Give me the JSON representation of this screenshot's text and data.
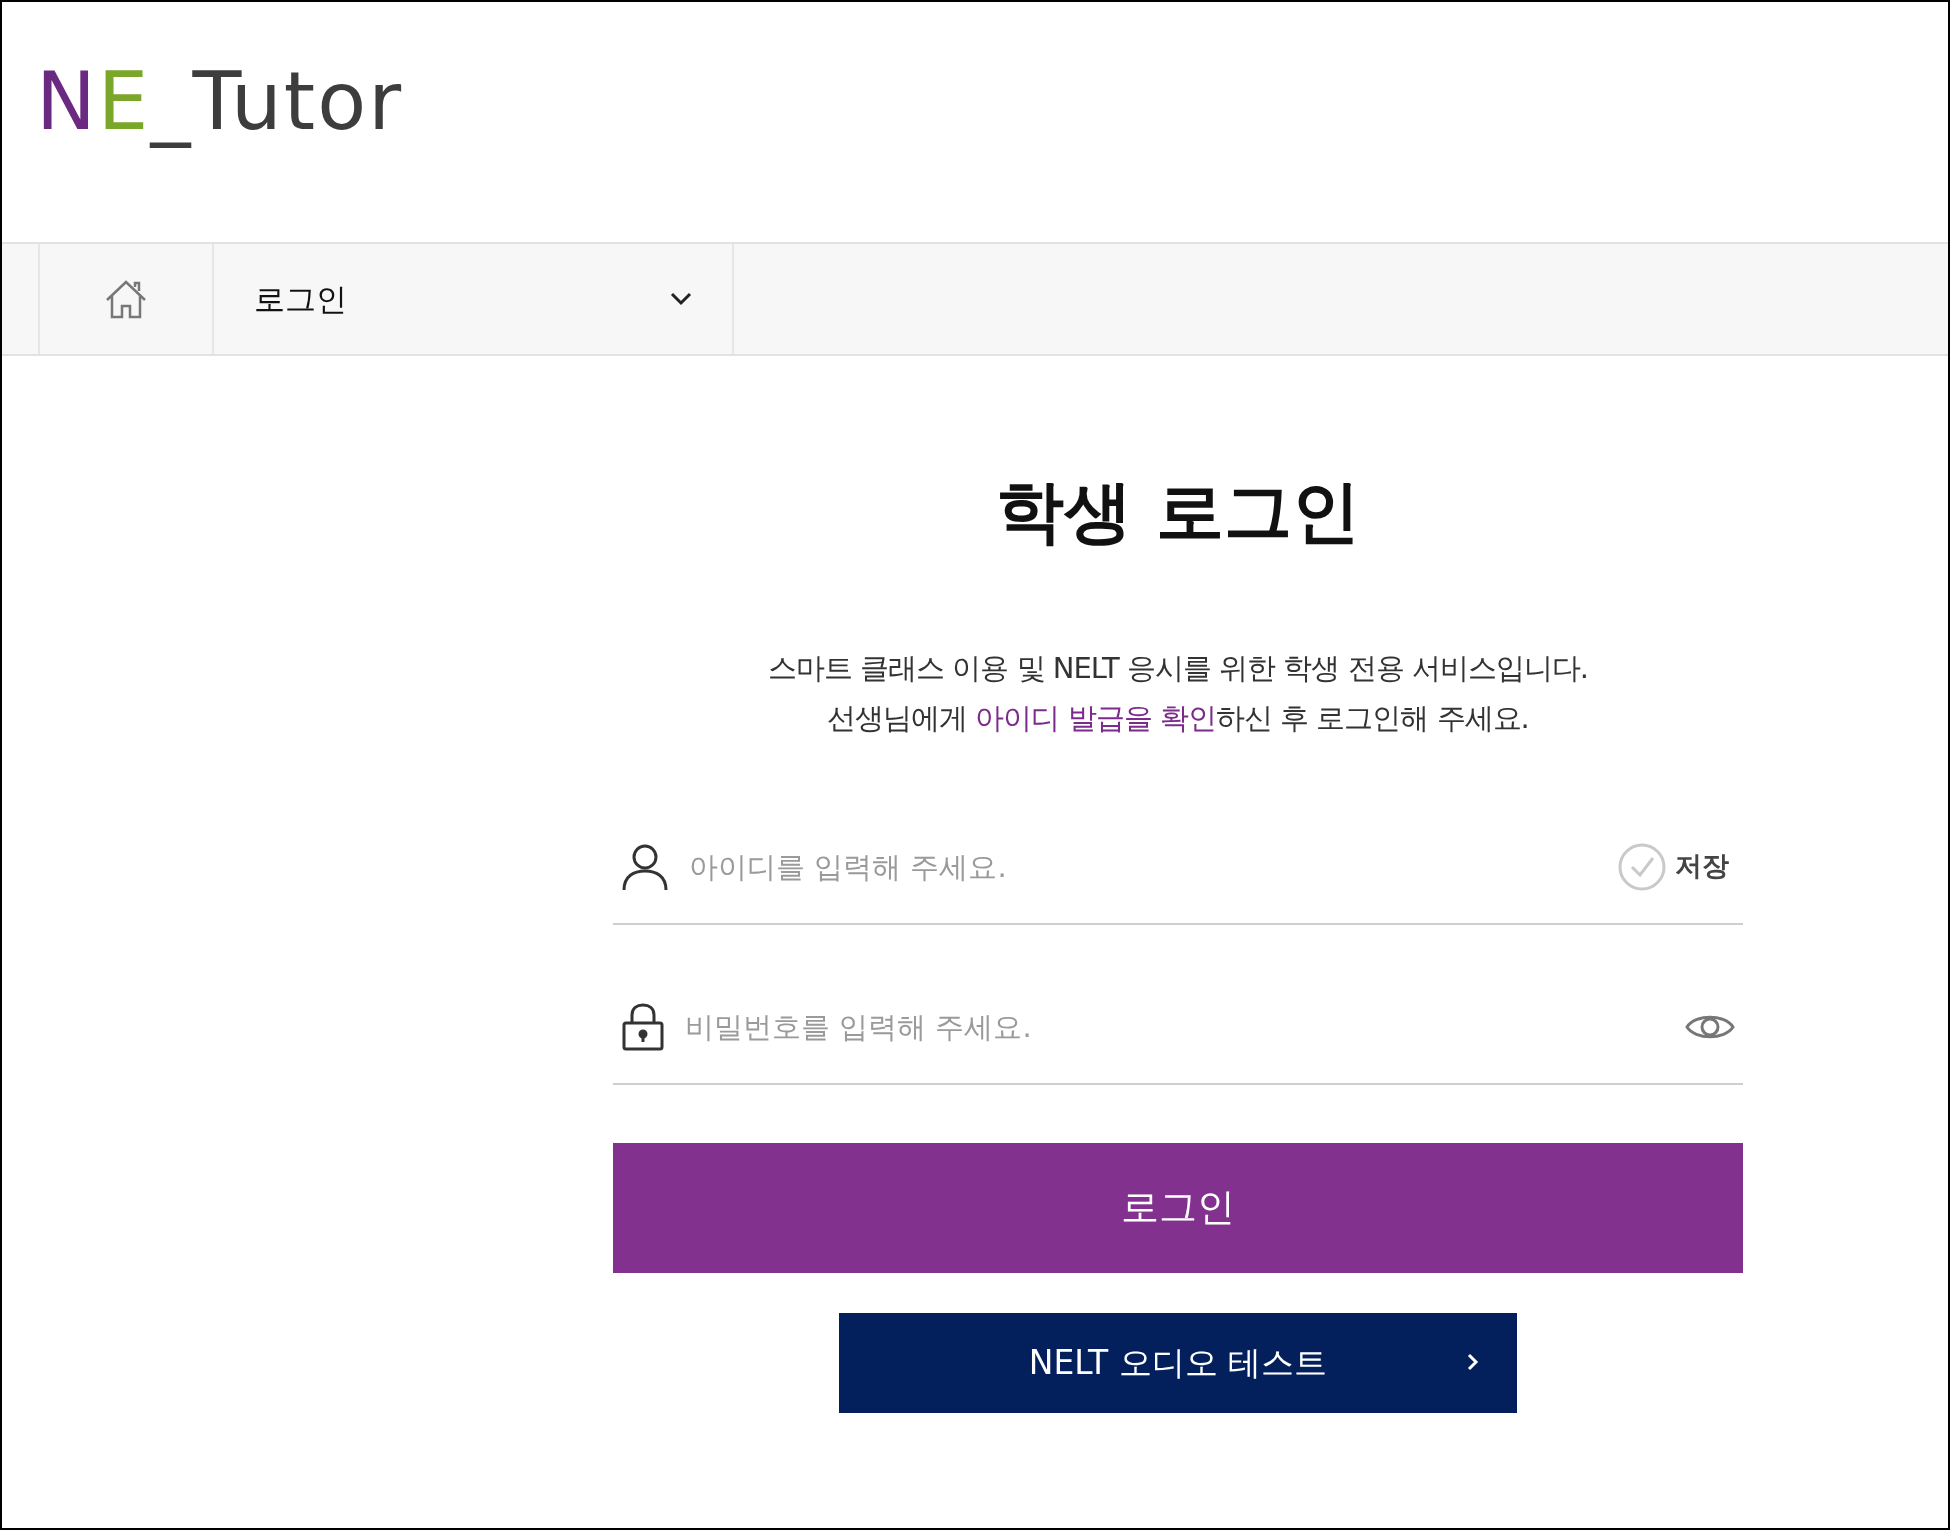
{
  "logo": "NE_Tutor",
  "breadcrumb": {
    "current": "로그인"
  },
  "title": "학생 로그인",
  "description": {
    "line1": "스마트 클래스 이용 및 NELT 응시를 위한 학생 전용 서비스입니다.",
    "line2_before": "선생님에게 ",
    "line2_link": "아이디 발급을 확인",
    "line2_after": "하신 후 로그인해 주세요."
  },
  "id_field": {
    "placeholder": "아이디를 입력해 주세요.",
    "save_label": "저장",
    "save_checked": false
  },
  "password_field": {
    "placeholder": "비밀번호를 입력해 주세요."
  },
  "login_button": "로그인",
  "audio_test_button": "NELT 오디오 테스트"
}
